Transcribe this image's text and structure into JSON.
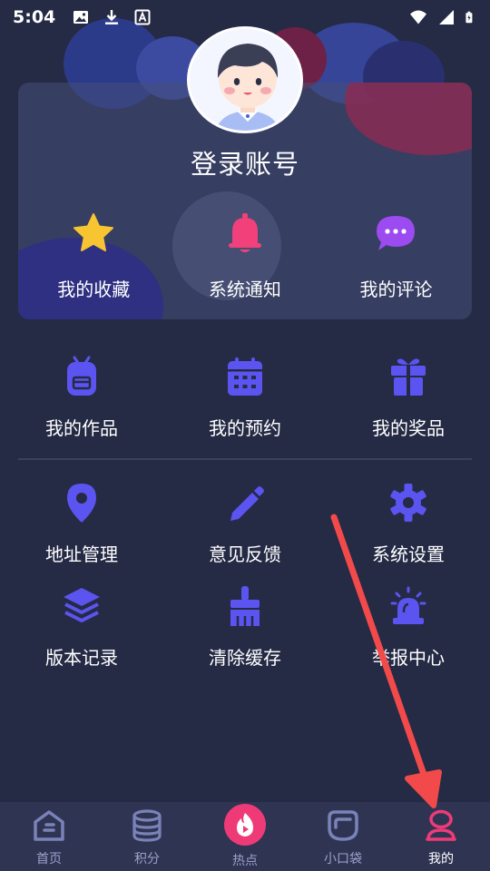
{
  "status_bar": {
    "time": "5:04"
  },
  "profile": {
    "login_title": "登录账号"
  },
  "quick_actions": [
    {
      "label": "我的收藏",
      "icon": "star-icon",
      "color": "#f7c432"
    },
    {
      "label": "系统通知",
      "icon": "bell-icon",
      "color": "#f2407a"
    },
    {
      "label": "我的评论",
      "icon": "chat-bubble-icon",
      "color": "#9b4bf0"
    }
  ],
  "menu_row1": [
    {
      "label": "我的作品",
      "icon": "backpack-icon"
    },
    {
      "label": "我的预约",
      "icon": "calendar-icon"
    },
    {
      "label": "我的奖品",
      "icon": "gift-icon"
    }
  ],
  "menu_row2": [
    {
      "label": "地址管理",
      "icon": "location-pin-icon"
    },
    {
      "label": "意见反馈",
      "icon": "pencil-icon"
    },
    {
      "label": "系统设置",
      "icon": "gear-icon"
    }
  ],
  "menu_row3": [
    {
      "label": "版本记录",
      "icon": "layers-icon"
    },
    {
      "label": "清除缓存",
      "icon": "broom-icon"
    },
    {
      "label": "举报中心",
      "icon": "siren-icon"
    }
  ],
  "bottom_nav": [
    {
      "label": "首页",
      "icon": "home-icon"
    },
    {
      "label": "积分",
      "icon": "database-icon"
    },
    {
      "label": "热点",
      "icon": "flame-play-icon"
    },
    {
      "label": "小口袋",
      "icon": "pocket-icon"
    },
    {
      "label": "我的",
      "icon": "user-icon",
      "active": true
    }
  ],
  "colors": {
    "background": "#252a45",
    "icon_blue": "#5b54f0",
    "accent_pink": "#ee3b78",
    "annotation_arrow": "#f24a4a"
  }
}
